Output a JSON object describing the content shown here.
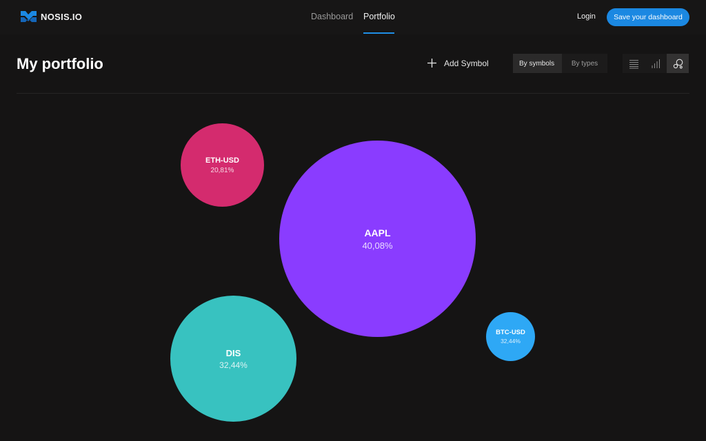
{
  "brand": {
    "name": "NOSIS.IO",
    "logo_icon": "nosis-logo-icon"
  },
  "nav": {
    "tabs": [
      {
        "label": "Dashboard",
        "active": false
      },
      {
        "label": "Portfolio",
        "active": true
      }
    ],
    "login_label": "Login",
    "save_label": "Save your dashboard"
  },
  "header": {
    "title": "My portfolio",
    "add_symbol_label": "Add Symbol",
    "group_by": {
      "options": [
        "By symbols",
        "By types"
      ],
      "selected": "By symbols"
    },
    "views": [
      {
        "icon": "list-view-icon",
        "selected": false
      },
      {
        "icon": "bar-chart-view-icon",
        "selected": false
      },
      {
        "icon": "bubble-view-icon",
        "selected": true
      }
    ]
  },
  "colors": {
    "background": "#151414",
    "accent": "#1b88e2",
    "eth": "#d42b6e",
    "aapl": "#8a3cff",
    "dis": "#38c2c0",
    "btc": "#2ea8f5"
  },
  "bubbles": [
    {
      "symbol": "AAPL",
      "percent": "40,08%",
      "share": 40.08,
      "color": "#8a3cff"
    },
    {
      "symbol": "DIS",
      "percent": "32,44%",
      "share": 32.44,
      "color": "#38c2c0"
    },
    {
      "symbol": "ETH-USD",
      "percent": "20,81%",
      "share": 20.81,
      "color": "#d42b6e"
    },
    {
      "symbol": "BTC-USD",
      "percent": "32,44%",
      "share": 32.44,
      "color": "#2ea8f5"
    }
  ]
}
